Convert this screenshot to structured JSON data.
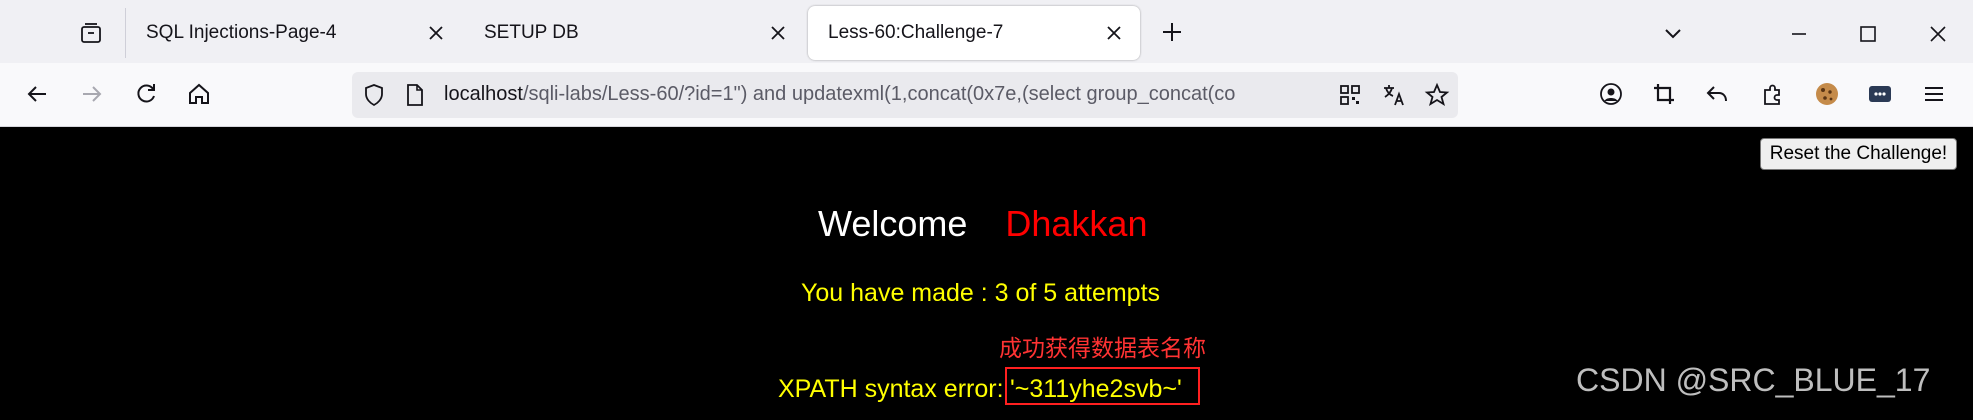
{
  "browser": {
    "tabs": [
      {
        "label": "SQL Injections-Page-4",
        "active": false
      },
      {
        "label": "SETUP DB",
        "active": false
      },
      {
        "label": "Less-60:Challenge-7",
        "active": true
      }
    ],
    "url": {
      "host": "localhost",
      "path": "/sqli-labs/Less-60/?id=1\") and updatexml(1,concat(0x7e,(select group_concat(co"
    }
  },
  "page": {
    "reset_button": "Reset the Challenge!",
    "welcome": "Welcome",
    "user_name": "Dhakkan",
    "attempts": "You have made : 3 of 5 attempts",
    "annotation": "成功获得数据表名称",
    "xpath_label": "XPATH syntax error:",
    "xpath_value": "'~311yhe2svb~'",
    "watermark": "CSDN @SRC_BLUE_17"
  },
  "colors": {
    "welcome_name": "#ff0000",
    "message": "#ffff00",
    "annotation": "#ff3333",
    "highlight_box": "#ff2020"
  }
}
